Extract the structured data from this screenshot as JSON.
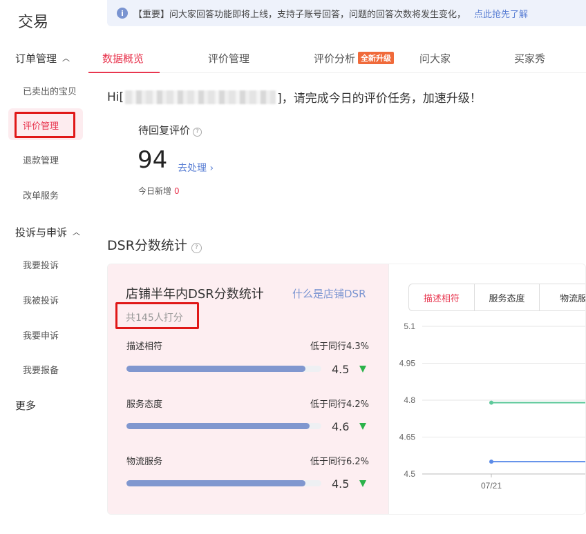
{
  "sidebar": {
    "title": "交易",
    "group_order": "订单管理",
    "items_order": [
      "已卖出的宝贝",
      "评价管理",
      "退款管理",
      "改单服务"
    ],
    "group_complaint": "投诉与申诉",
    "items_complaint": [
      "我要投诉",
      "我被投诉",
      "我要申诉",
      "我要报备"
    ],
    "more": "更多"
  },
  "notice": {
    "text": "【重要】问大家回答功能即将上线，支持子账号回答，问题的回答次数将发生变化，",
    "link": "点此抢先了解"
  },
  "tabs": {
    "items": [
      "数据概览",
      "评价管理",
      "评价分析",
      "问大家",
      "买家秀"
    ],
    "badge": "全新升级"
  },
  "greeting": {
    "prefix": "Hi[",
    "suffix": "]，请完成今日的评价任务，加速升级！"
  },
  "pending": {
    "title": "待回复评价",
    "count": "94",
    "action": "去处理",
    "today_label": "今日新增",
    "today_value": "0"
  },
  "dsr": {
    "section_title": "DSR分数统计",
    "card_title": "店铺半年内DSR分数统计",
    "card_link": "什么是店铺DSR",
    "raters": "共145人打分",
    "metrics": [
      {
        "name": "描述相符",
        "compare": "低于同行4.3%",
        "score": "4.5",
        "level": 0.92
      },
      {
        "name": "服务态度",
        "compare": "低于同行4.2%",
        "score": "4.6",
        "level": 0.94
      },
      {
        "name": "物流服务",
        "compare": "低于同行6.2%",
        "score": "4.5",
        "level": 0.92
      }
    ]
  },
  "chart_tabs": [
    "描述相符",
    "服务态度",
    "物流服务"
  ],
  "chart_data": {
    "type": "line",
    "x": [
      "07/21"
    ],
    "series": [
      {
        "color": "#5ec99b",
        "values": [
          4.79
        ]
      },
      {
        "color": "#5b8be8",
        "values": [
          4.55
        ]
      }
    ],
    "ylim": [
      4.5,
      5.1
    ],
    "yticks": [
      "5.1",
      "4.95",
      "4.8",
      "4.65",
      "4.5"
    ],
    "grid": true
  },
  "colors": {
    "accent": "#e8364f",
    "link": "#5a7fd4",
    "bar": "#8097cf",
    "down_arrow": "#2bb24a",
    "highlight_box": "#e01818"
  }
}
